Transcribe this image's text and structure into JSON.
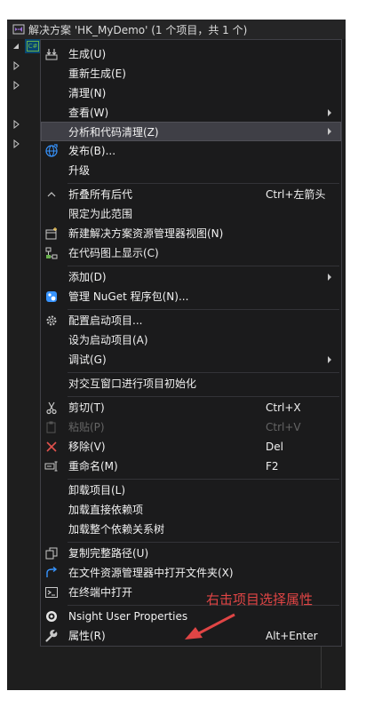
{
  "solution_explorer": {
    "header": "解决方案 'HK_MyDemo' (1 个项目，共 1 个)",
    "project_badge": "C#"
  },
  "context_menu": {
    "items": [
      {
        "label": "生成(U)",
        "icon": "build-icon"
      },
      {
        "label": "重新生成(E)"
      },
      {
        "label": "清理(N)"
      },
      {
        "label": "查看(W)",
        "submenu": true
      },
      {
        "label": "分析和代码清理(Z)",
        "submenu": true,
        "highlighted": true
      },
      {
        "label": "发布(B)...",
        "icon": "publish-globe-icon"
      },
      {
        "label": "升级"
      },
      {
        "label": "折叠所有后代",
        "shortcut": "Ctrl+左箭头",
        "icon": "collapse-chevron-icon"
      },
      {
        "label": "限定为此范围"
      },
      {
        "label": "新建解决方案资源管理器视图(N)",
        "icon": "new-view-icon"
      },
      {
        "label": "在代码图上显示(C)",
        "icon": "code-map-icon"
      },
      {
        "label": "添加(D)",
        "submenu": true
      },
      {
        "label": "管理 NuGet 程序包(N)...",
        "icon": "nuget-icon"
      },
      {
        "label": "配置启动项目...",
        "icon": "gear-icon"
      },
      {
        "label": "设为启动项目(A)"
      },
      {
        "label": "调试(G)",
        "submenu": true
      },
      {
        "label": "对交互窗口进行项目初始化"
      },
      {
        "label": "剪切(T)",
        "shortcut": "Ctrl+X",
        "icon": "scissors-icon"
      },
      {
        "label": "粘贴(P)",
        "shortcut": "Ctrl+V",
        "icon": "paste-icon",
        "disabled": true
      },
      {
        "label": "移除(V)",
        "shortcut": "Del",
        "icon": "remove-x-icon"
      },
      {
        "label": "重命名(M)",
        "shortcut": "F2",
        "icon": "rename-icon"
      },
      {
        "label": "卸载项目(L)"
      },
      {
        "label": "加载直接依赖项"
      },
      {
        "label": "加载整个依赖关系树"
      },
      {
        "label": "复制完整路径(U)",
        "icon": "copy-path-icon"
      },
      {
        "label": "在文件资源管理器中打开文件夹(X)",
        "icon": "open-folder-arrow-icon"
      },
      {
        "label": "在终端中打开",
        "icon": "terminal-icon"
      },
      {
        "label": "Nsight User Properties",
        "icon": "nsight-icon"
      },
      {
        "label": "属性(R)",
        "shortcut": "Alt+Enter",
        "icon": "wrench-icon"
      }
    ]
  },
  "annotation": {
    "text": "右击项目选择属性",
    "color": "#e04545"
  },
  "colors": {
    "menu_bg": "#1b1b1c",
    "ide_bg": "#1e1e1e",
    "highlight_bg": "#3f3f46",
    "selection_blue": "#094771"
  }
}
